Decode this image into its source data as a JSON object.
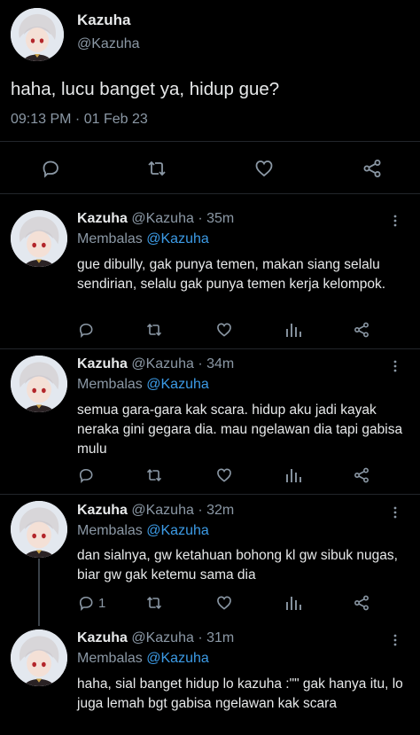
{
  "main_tweet": {
    "display_name": "Kazuha",
    "handle": "@Kazuha",
    "text": "haha, lucu banget ya, hidup gue?",
    "timestamp": "09:13 PM · 01 Feb 23",
    "icons": [
      "reply-icon",
      "retweet-icon",
      "like-icon",
      "share-icon"
    ]
  },
  "replies": [
    {
      "display_name": "Kazuha",
      "handle_time": "@Kazuha · 35m",
      "replying_label": "Membalas",
      "replying_to": "@Kazuha",
      "text": "gue dibully, gak punya temen, makan siang selalu sendirian, selalu gak punya temen kerja kelompok.",
      "reply_count": ""
    },
    {
      "display_name": "Kazuha",
      "handle_time": "@Kazuha · 34m",
      "replying_label": "Membalas",
      "replying_to": "@Kazuha",
      "text": "semua gara-gara kak scara. hidup aku jadi kayak neraka gini gegara dia. mau ngelawan dia tapi gabisa mulu",
      "reply_count": ""
    },
    {
      "display_name": "Kazuha",
      "handle_time": "@Kazuha · 32m",
      "replying_label": "Membalas",
      "replying_to": "@Kazuha",
      "text": "dan sialnya, gw ketahuan bohong kl gw sibuk nugas, biar gw gak ketemu sama dia",
      "reply_count": "1"
    },
    {
      "display_name": "Kazuha",
      "handle_time": "@Kazuha · 31m",
      "replying_label": "Membalas",
      "replying_to": "@Kazuha",
      "text": "haha, sial banget hidup lo kazuha :\"\" gak hanya itu, lo juga lemah bgt gabisa ngelawan kak scara",
      "reply_count": ""
    }
  ],
  "colors": {
    "background": "#000000",
    "text": "#e7e9ea",
    "secondary": "#8b98a5",
    "accent": "#3c9be6",
    "divider": "#22262b"
  }
}
